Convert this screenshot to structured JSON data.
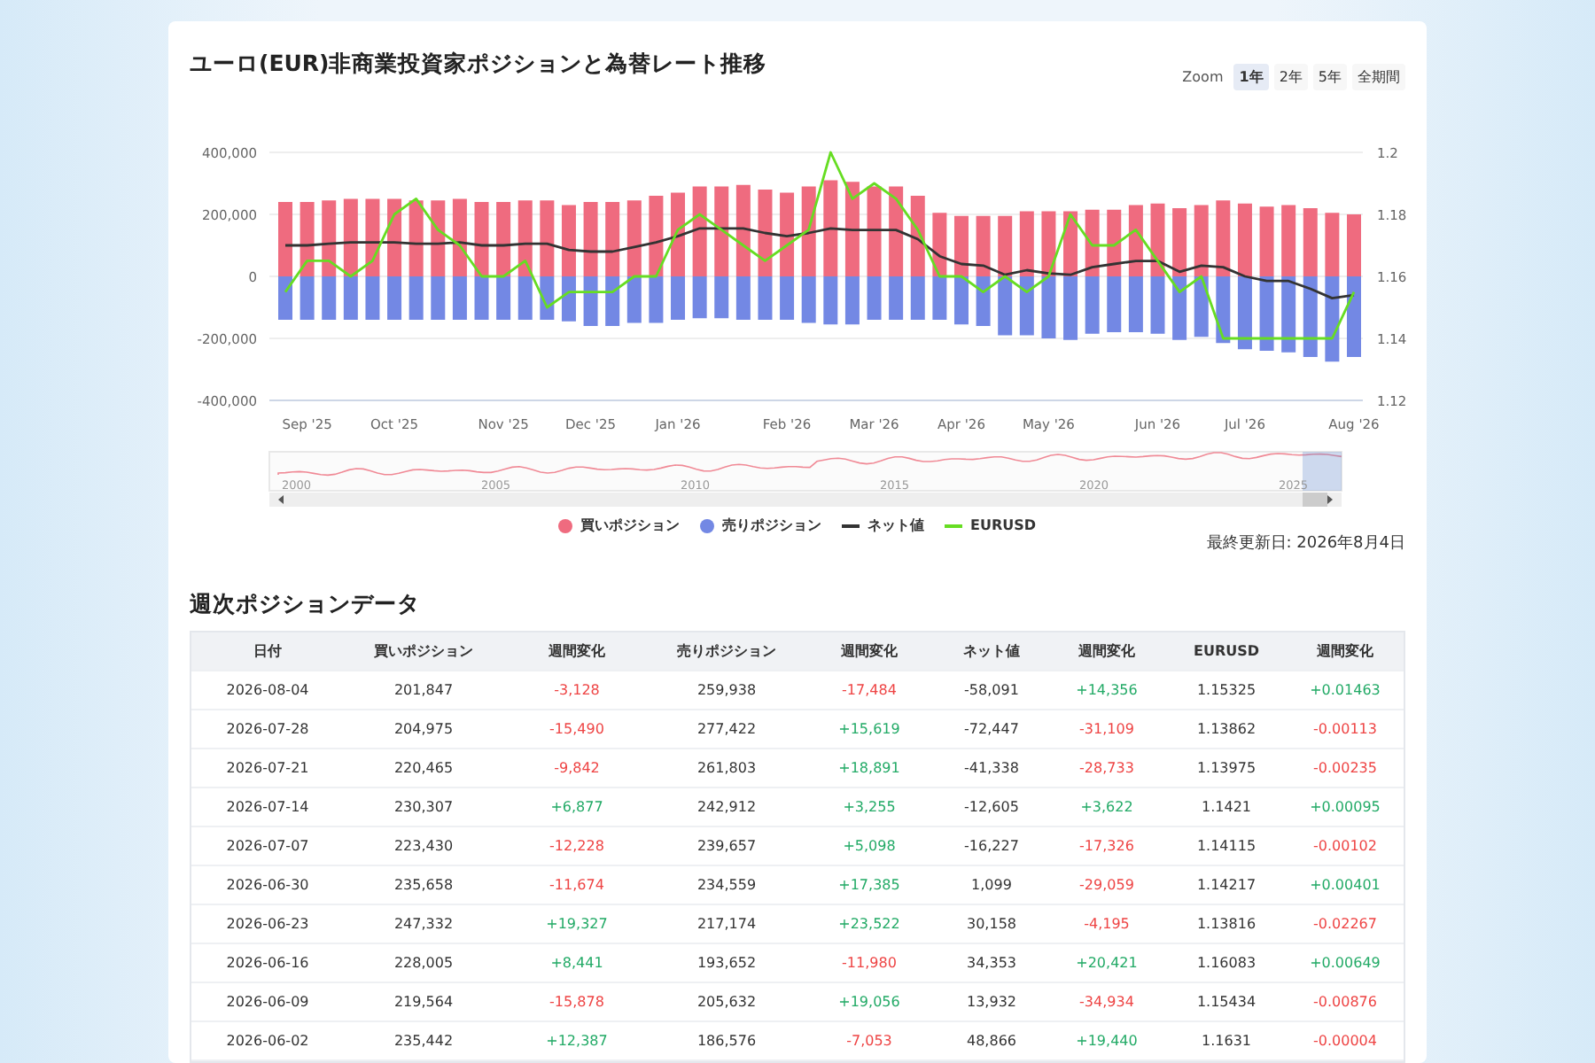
{
  "chart_panel": {
    "title": "ユーロ(EUR)非商業投資家ポジションと為替レート推移",
    "zoom": {
      "label": "Zoom",
      "options": [
        {
          "label": "1年",
          "selected": true
        },
        {
          "label": "2年",
          "selected": false
        },
        {
          "label": "5年",
          "selected": false
        },
        {
          "label": "全期間",
          "selected": false
        }
      ]
    },
    "chart_data": {
      "type": "bar",
      "stacked": true,
      "grid": true,
      "categories": [
        null,
        "Sep '25",
        null,
        null,
        null,
        "Oct '25",
        null,
        null,
        null,
        null,
        "Nov '25",
        null,
        null,
        null,
        "Dec '25",
        null,
        null,
        null,
        "Jan '26",
        null,
        null,
        null,
        null,
        "Feb '26",
        null,
        null,
        null,
        "Mar '26",
        null,
        null,
        null,
        "Apr '26",
        null,
        null,
        null,
        "May '26",
        null,
        null,
        null,
        null,
        "Jun '26",
        null,
        null,
        null,
        "Jul '26",
        null,
        null,
        null,
        null,
        "Aug '26"
      ],
      "series": [
        {
          "name": "買いポジション",
          "color": "#ef6b7f",
          "values": [
            240000,
            240000,
            245000,
            250000,
            250000,
            250000,
            245000,
            245000,
            250000,
            240000,
            240000,
            245000,
            245000,
            230000,
            240000,
            240000,
            245000,
            260000,
            270000,
            290000,
            290000,
            295000,
            280000,
            270000,
            290000,
            310000,
            305000,
            290000,
            290000,
            260000,
            205000,
            195000,
            195000,
            195000,
            210000,
            210000,
            210000,
            215000,
            215000,
            230000,
            235000,
            220000,
            230000,
            245000,
            235000,
            225000,
            230000,
            220000,
            205000,
            200000
          ]
        },
        {
          "name": "売りポジション",
          "color": "#7388e4",
          "values": [
            -140000,
            -140000,
            -140000,
            -140000,
            -140000,
            -140000,
            -140000,
            -140000,
            -140000,
            -140000,
            -140000,
            -140000,
            -140000,
            -145000,
            -160000,
            -160000,
            -150000,
            -150000,
            -140000,
            -135000,
            -135000,
            -140000,
            -140000,
            -140000,
            -150000,
            -155000,
            -155000,
            -140000,
            -140000,
            -140000,
            -140000,
            -155000,
            -160000,
            -190000,
            -190000,
            -200000,
            -205000,
            -185000,
            -180000,
            -180000,
            -185000,
            -205000,
            -195000,
            -215000,
            -235000,
            -240000,
            -245000,
            -260000,
            -275000,
            -260000
          ]
        },
        {
          "name": "ネット値",
          "color": "#333333",
          "type": "line",
          "values": [
            100000,
            100000,
            105000,
            110000,
            110000,
            110000,
            105000,
            105000,
            110000,
            100000,
            100000,
            105000,
            105000,
            85000,
            80000,
            80000,
            95000,
            110000,
            130000,
            155000,
            155000,
            155000,
            140000,
            130000,
            140000,
            155000,
            150000,
            150000,
            150000,
            120000,
            65000,
            40000,
            35000,
            5000,
            20000,
            10000,
            5000,
            30000,
            40000,
            50000,
            50000,
            15000,
            35000,
            30000,
            0,
            -15000,
            -15000,
            -40000,
            -70000,
            -60000
          ]
        },
        {
          "name": "EURUSD",
          "color": "#66dd22",
          "type": "line",
          "axis": "y2",
          "values": [
            1.155,
            1.165,
            1.165,
            1.16,
            1.165,
            1.18,
            1.185,
            1.175,
            1.17,
            1.16,
            1.16,
            1.165,
            1.15,
            1.155,
            1.155,
            1.155,
            1.16,
            1.16,
            1.175,
            1.18,
            1.175,
            1.17,
            1.165,
            1.17,
            1.175,
            1.2,
            1.185,
            1.19,
            1.185,
            1.175,
            1.16,
            1.16,
            1.155,
            1.16,
            1.155,
            1.16,
            1.18,
            1.17,
            1.17,
            1.175,
            1.165,
            1.155,
            1.16,
            1.14,
            1.14,
            1.14,
            1.14,
            1.14,
            1.14,
            1.155
          ]
        }
      ],
      "ylim": [
        -400000,
        400000
      ],
      "yticks": [
        {
          "value": -400000,
          "label": "-400,000"
        },
        {
          "value": -200000,
          "label": "-200,000"
        },
        {
          "value": 0,
          "label": "0"
        },
        {
          "value": 200000,
          "label": "200,000"
        },
        {
          "value": 400000,
          "label": "400,000"
        }
      ],
      "y2lim": [
        1.12,
        1.2
      ],
      "y2ticks": [
        {
          "value": 1.12,
          "label": "1.12"
        },
        {
          "value": 1.14,
          "label": "1.14"
        },
        {
          "value": 1.16,
          "label": "1.16"
        },
        {
          "value": 1.18,
          "label": "1.18"
        },
        {
          "value": 1.2,
          "label": "1.2"
        }
      ]
    },
    "navigator": {
      "years": [
        "2000",
        "2005",
        "2010",
        "2015",
        "2020",
        "2025"
      ]
    },
    "updated": "最終更新日: 2026年8月4日"
  },
  "table_section": {
    "title": "週次ポジションデータ",
    "columns": [
      "日付",
      "買いポジション",
      "週間変化",
      "売りポジション",
      "週間変化",
      "ネット値",
      "週間変化",
      "EURUSD",
      "週間変化"
    ],
    "rows": [
      {
        "cells": [
          {
            "text": "2026-08-04"
          },
          {
            "text": "201,847"
          },
          {
            "text": "-3,128",
            "rising": false
          },
          {
            "text": "259,938"
          },
          {
            "text": "-17,484",
            "rising": false
          },
          {
            "text": "-58,091"
          },
          {
            "text": "+14,356",
            "rising": true
          },
          {
            "text": "1.15325"
          },
          {
            "text": "+0.01463",
            "rising": true
          }
        ]
      },
      {
        "cells": [
          {
            "text": "2026-07-28"
          },
          {
            "text": "204,975"
          },
          {
            "text": "-15,490",
            "rising": false
          },
          {
            "text": "277,422"
          },
          {
            "text": "+15,619",
            "rising": true
          },
          {
            "text": "-72,447"
          },
          {
            "text": "-31,109",
            "rising": false
          },
          {
            "text": "1.13862"
          },
          {
            "text": "-0.00113",
            "rising": false
          }
        ]
      },
      {
        "cells": [
          {
            "text": "2026-07-21"
          },
          {
            "text": "220,465"
          },
          {
            "text": "-9,842",
            "rising": false
          },
          {
            "text": "261,803"
          },
          {
            "text": "+18,891",
            "rising": true
          },
          {
            "text": "-41,338"
          },
          {
            "text": "-28,733",
            "rising": false
          },
          {
            "text": "1.13975"
          },
          {
            "text": "-0.00235",
            "rising": false
          }
        ]
      },
      {
        "cells": [
          {
            "text": "2026-07-14"
          },
          {
            "text": "230,307"
          },
          {
            "text": "+6,877",
            "rising": true
          },
          {
            "text": "242,912"
          },
          {
            "text": "+3,255",
            "rising": true
          },
          {
            "text": "-12,605"
          },
          {
            "text": "+3,622",
            "rising": true
          },
          {
            "text": "1.1421"
          },
          {
            "text": "+0.00095",
            "rising": true
          }
        ]
      },
      {
        "cells": [
          {
            "text": "2026-07-07"
          },
          {
            "text": "223,430"
          },
          {
            "text": "-12,228",
            "rising": false
          },
          {
            "text": "239,657"
          },
          {
            "text": "+5,098",
            "rising": true
          },
          {
            "text": "-16,227"
          },
          {
            "text": "-17,326",
            "rising": false
          },
          {
            "text": "1.14115"
          },
          {
            "text": "-0.00102",
            "rising": false
          }
        ]
      },
      {
        "cells": [
          {
            "text": "2026-06-30"
          },
          {
            "text": "235,658"
          },
          {
            "text": "-11,674",
            "rising": false
          },
          {
            "text": "234,559"
          },
          {
            "text": "+17,385",
            "rising": true
          },
          {
            "text": "1,099"
          },
          {
            "text": "-29,059",
            "rising": false
          },
          {
            "text": "1.14217"
          },
          {
            "text": "+0.00401",
            "rising": true
          }
        ]
      },
      {
        "cells": [
          {
            "text": "2026-06-23"
          },
          {
            "text": "247,332"
          },
          {
            "text": "+19,327",
            "rising": true
          },
          {
            "text": "217,174"
          },
          {
            "text": "+23,522",
            "rising": true
          },
          {
            "text": "30,158"
          },
          {
            "text": "-4,195",
            "rising": false
          },
          {
            "text": "1.13816"
          },
          {
            "text": "-0.02267",
            "rising": false
          }
        ]
      },
      {
        "cells": [
          {
            "text": "2026-06-16"
          },
          {
            "text": "228,005"
          },
          {
            "text": "+8,441",
            "rising": true
          },
          {
            "text": "193,652"
          },
          {
            "text": "-11,980",
            "rising": false
          },
          {
            "text": "34,353"
          },
          {
            "text": "+20,421",
            "rising": true
          },
          {
            "text": "1.16083"
          },
          {
            "text": "+0.00649",
            "rising": true
          }
        ]
      },
      {
        "cells": [
          {
            "text": "2026-06-09"
          },
          {
            "text": "219,564"
          },
          {
            "text": "-15,878",
            "rising": false
          },
          {
            "text": "205,632"
          },
          {
            "text": "+19,056",
            "rising": true
          },
          {
            "text": "13,932"
          },
          {
            "text": "-34,934",
            "rising": false
          },
          {
            "text": "1.15434"
          },
          {
            "text": "-0.00876",
            "rising": false
          }
        ]
      },
      {
        "cells": [
          {
            "text": "2026-06-02"
          },
          {
            "text": "235,442"
          },
          {
            "text": "+12,387",
            "rising": true
          },
          {
            "text": "186,576"
          },
          {
            "text": "-7,053",
            "rising": false
          },
          {
            "text": "48,866"
          },
          {
            "text": "+19,440",
            "rising": true
          },
          {
            "text": "1.1631"
          },
          {
            "text": "-0.00004",
            "rising": false
          }
        ]
      }
    ]
  }
}
